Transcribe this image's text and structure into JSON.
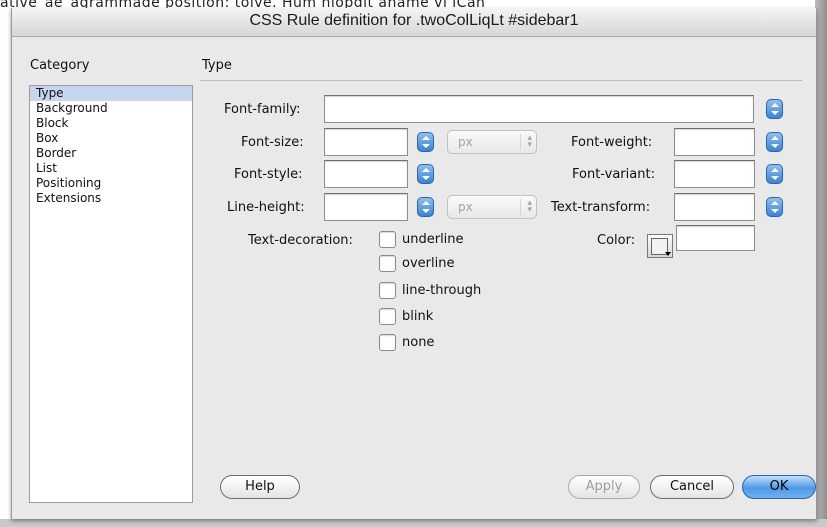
{
  "background_document": {
    "partial_text": "ative_ae_agrammade position: tolve. Hum hiopdit aname vi iCan"
  },
  "dialog": {
    "title": "CSS Rule definition for .twoColLiqLt #sidebar1",
    "category_heading": "Category",
    "section_heading": "Type",
    "selected_category": "Type",
    "categories": [
      "Type",
      "Background",
      "Block",
      "Box",
      "Border",
      "List",
      "Positioning",
      "Extensions"
    ]
  },
  "form": {
    "font_family": {
      "label": "Font-family:",
      "value": ""
    },
    "font_size": {
      "label": "Font-size:",
      "value": "",
      "unit": "px"
    },
    "font_weight": {
      "label": "Font-weight:",
      "value": ""
    },
    "font_style": {
      "label": "Font-style:",
      "value": ""
    },
    "font_variant": {
      "label": "Font-variant:",
      "value": ""
    },
    "line_height": {
      "label": "Line-height:",
      "value": "",
      "unit": "px"
    },
    "text_transform": {
      "label": "Text-transform:",
      "value": ""
    },
    "text_decoration": {
      "label": "Text-decoration:",
      "options": [
        {
          "label": "underline",
          "checked": false
        },
        {
          "label": "overline",
          "checked": false
        },
        {
          "label": "line-through",
          "checked": false
        },
        {
          "label": "blink",
          "checked": false
        },
        {
          "label": "none",
          "checked": false
        }
      ]
    },
    "color": {
      "label": "Color:",
      "value": ""
    }
  },
  "buttons": {
    "help": "Help",
    "apply": "Apply",
    "cancel": "Cancel",
    "ok": "OK"
  },
  "colors": {
    "selection_highlight": "#c6d6ee",
    "stepper_blue": "#3a82d8",
    "dialog_background": "#e9e9e9"
  },
  "icons": {
    "stepper": "up-down-arrows-icon",
    "unit_select": "up-down-chevron-icon",
    "color_picker": "color-swatch-icon"
  }
}
